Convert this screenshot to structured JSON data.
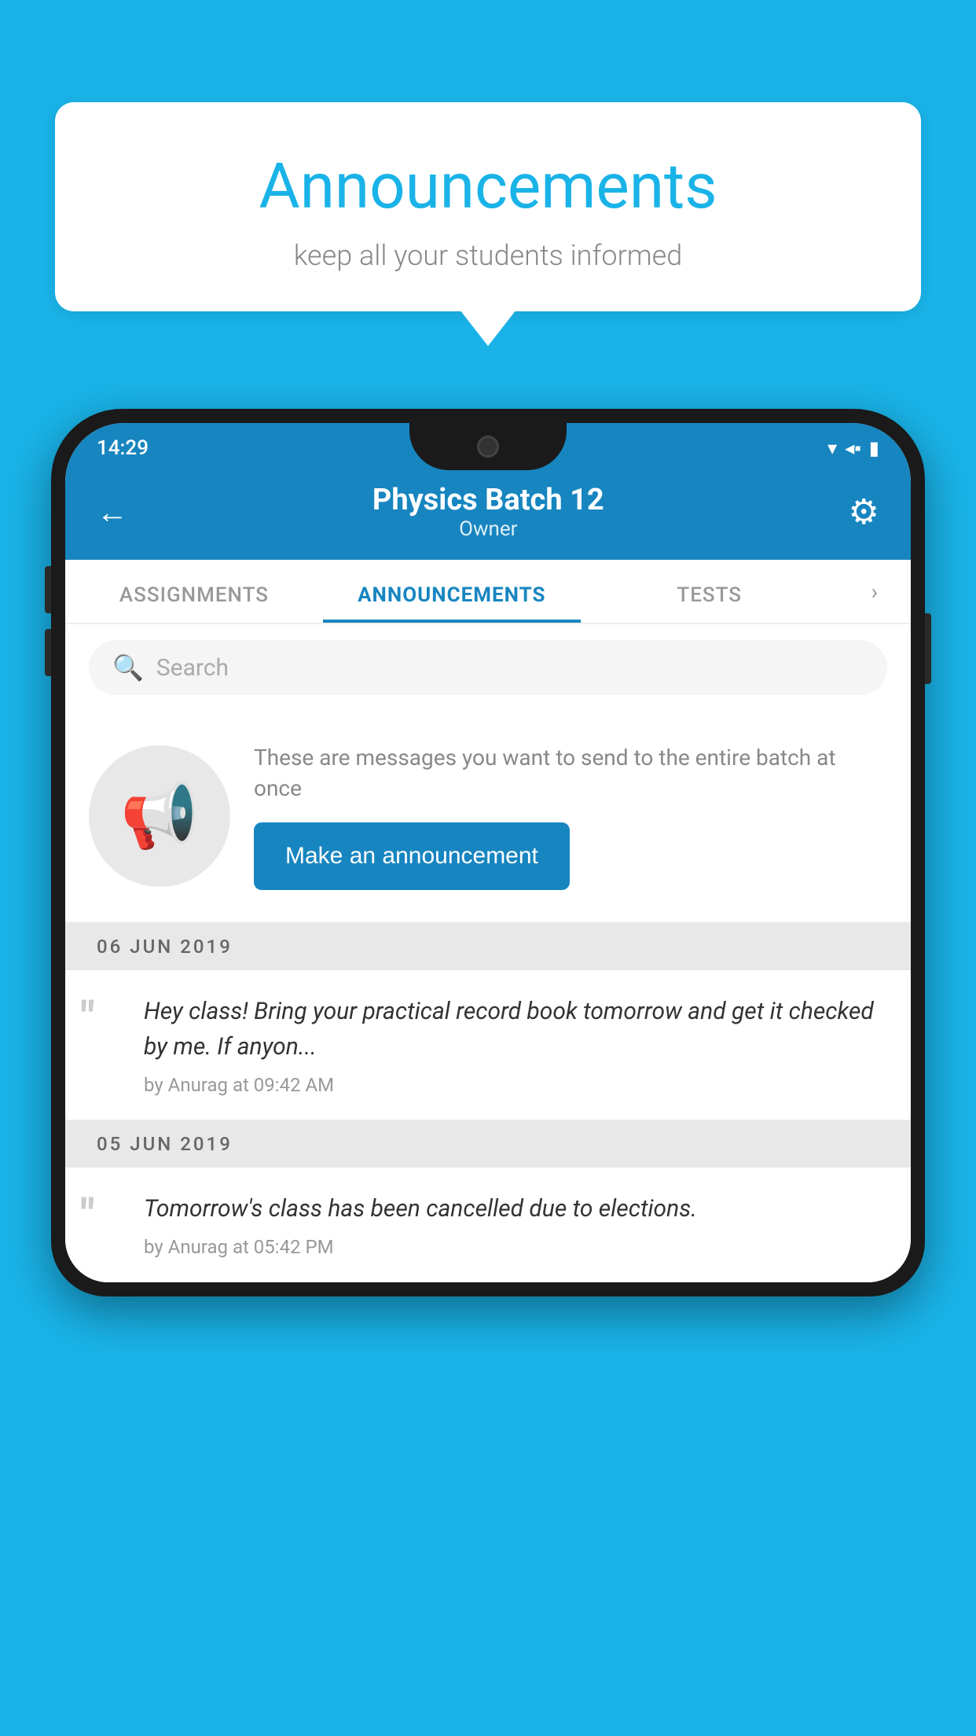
{
  "background_color": "#1ab3e8",
  "speech_bubble": {
    "title": "Announcements",
    "subtitle": "keep all your students informed"
  },
  "phone": {
    "status_bar": {
      "time": "14:29",
      "wifi_icon": "▼",
      "signal_icon": "◀",
      "battery_icon": "▮"
    },
    "header": {
      "back_label": "←",
      "title": "Physics Batch 12",
      "subtitle": "Owner",
      "gear_icon": "⚙"
    },
    "tabs": [
      {
        "label": "ASSIGNMENTS",
        "active": false
      },
      {
        "label": "ANNOUNCEMENTS",
        "active": true
      },
      {
        "label": "TESTS",
        "active": false
      }
    ],
    "search": {
      "placeholder": "Search"
    },
    "announcement_cta": {
      "description": "These are messages you want to send to the entire batch at once",
      "button_label": "Make an announcement"
    },
    "announcements": [
      {
        "date": "06  JUN  2019",
        "text": "Hey class! Bring your practical record book tomorrow and get it checked by me. If anyon...",
        "meta": "by Anurag at 09:42 AM"
      },
      {
        "date": "05  JUN  2019",
        "text": "Tomorrow's class has been cancelled due to elections.",
        "meta": "by Anurag at 05:42 PM"
      }
    ]
  }
}
